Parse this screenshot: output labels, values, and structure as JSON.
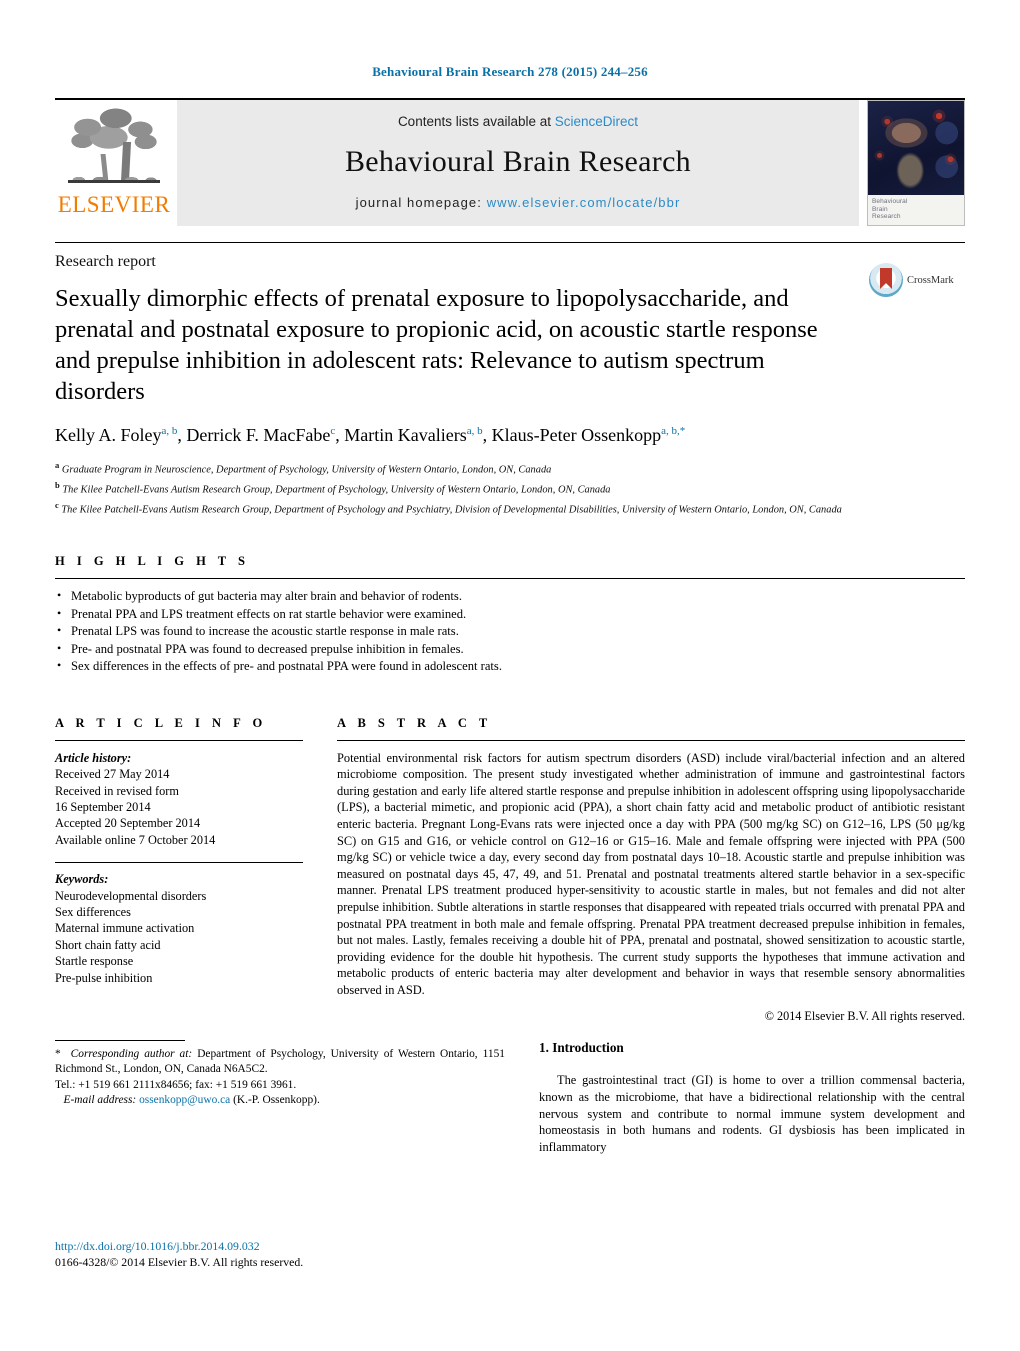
{
  "running_head": "Behavioural Brain Research 278 (2015) 244–256",
  "masthead": {
    "publisher_name": "ELSEVIER",
    "contents_prefix": "Contents lists available at ",
    "contents_link": "ScienceDirect",
    "journal_name": "Behavioural Brain Research",
    "homepage_prefix": "journal homepage: ",
    "homepage_url": "www.elsevier.com/locate/bbr",
    "cover_label_lines": [
      "Behavioural",
      "Brain",
      "Research"
    ]
  },
  "article": {
    "doctype": "Research report",
    "crossmark_label": "CrossMark",
    "title": "Sexually dimorphic effects of prenatal exposure to lipopolysaccharide, and prenatal and postnatal exposure to propionic acid, on acoustic startle response and prepulse inhibition in adolescent rats: Relevance to autism spectrum disorders",
    "authors_html": "Kelly A. Foley<sup>a, b</sup>, Derrick F. MacFabe<sup>c</sup>, Martin Kavaliers<sup>a, b</sup>, Klaus-Peter Ossenkopp<sup>a, b,</sup><sup>*</sup>",
    "affiliations": [
      {
        "mark": "a",
        "text": "Graduate Program in Neuroscience, Department of Psychology, University of Western Ontario, London, ON, Canada"
      },
      {
        "mark": "b",
        "text": "The Kilee Patchell-Evans Autism Research Group, Department of Psychology, University of Western Ontario, London, ON, Canada"
      },
      {
        "mark": "c",
        "text": "The Kilee Patchell-Evans Autism Research Group, Department of Psychology and Psychiatry, Division of Developmental Disabilities, University of Western Ontario, London, ON, Canada"
      }
    ]
  },
  "highlights": {
    "heading": "H I G H L I G H T S",
    "items": [
      "Metabolic byproducts of gut bacteria may alter brain and behavior of rodents.",
      "Prenatal PPA and LPS treatment effects on rat startle behavior were examined.",
      "Prenatal LPS was found to increase the acoustic startle response in male rats.",
      "Pre- and postnatal PPA was found to decreased prepulse inhibition in females.",
      "Sex differences in the effects of pre- and postnatal PPA were found in adolescent rats."
    ]
  },
  "article_info": {
    "heading": "A R T I C L E   I N F O",
    "history_label": "Article history:",
    "history_lines": [
      "Received 27 May 2014",
      "Received in revised form",
      "16 September 2014",
      "Accepted 20 September 2014",
      "Available online 7 October 2014"
    ],
    "keywords_label": "Keywords:",
    "keywords": [
      "Neurodevelopmental disorders",
      "Sex differences",
      "Maternal immune activation",
      "Short chain fatty acid",
      "Startle response",
      "Pre-pulse inhibition"
    ]
  },
  "abstract": {
    "heading": "A B S T R A C T",
    "text": "Potential environmental risk factors for autism spectrum disorders (ASD) include viral/bacterial infection and an altered microbiome composition. The present study investigated whether administration of immune and gastrointestinal factors during gestation and early life altered startle response and prepulse inhibition in adolescent offspring using lipopolysaccharide (LPS), a bacterial mimetic, and propionic acid (PPA), a short chain fatty acid and metabolic product of antibiotic resistant enteric bacteria. Pregnant Long-Evans rats were injected once a day with PPA (500 mg/kg SC) on G12–16, LPS (50 μg/kg SC) on G15 and G16, or vehicle control on G12–16 or G15–16. Male and female offspring were injected with PPA (500 mg/kg SC) or vehicle twice a day, every second day from postnatal days 10–18. Acoustic startle and prepulse inhibition was measured on postnatal days 45, 47, 49, and 51. Prenatal and postnatal treatments altered startle behavior in a sex-specific manner. Prenatal LPS treatment produced hyper-sensitivity to acoustic startle in males, but not females and did not alter prepulse inhibition. Subtle alterations in startle responses that disappeared with repeated trials occurred with prenatal PPA and postnatal PPA treatment in both male and female offspring. Prenatal PPA treatment decreased prepulse inhibition in females, but not males. Lastly, females receiving a double hit of PPA, prenatal and postnatal, showed sensitization to acoustic startle, providing evidence for the double hit hypothesis. The current study supports the hypotheses that immune activation and metabolic products of enteric bacteria may alter development and behavior in ways that resemble sensory abnormalities observed in ASD.",
    "copyright": "© 2014 Elsevier B.V. All rights reserved."
  },
  "footnote": {
    "corresponding_label": "Corresponding author at:",
    "corresponding_text": " Department of Psychology, University of Western Ontario, 1151 Richmond St., London, ON, Canada N6A5C2.",
    "tel_line": "Tel.: +1 519 661 2111x84656; fax: +1 519 661 3961.",
    "email_label": "E-mail address:",
    "email": "ossenkopp@uwo.ca",
    "email_suffix": " (K.-P. Ossenkopp)."
  },
  "footer": {
    "doi": "http://dx.doi.org/10.1016/j.bbr.2014.09.032",
    "issn_line": "0166-4328/© 2014 Elsevier B.V. All rights reserved."
  },
  "introduction": {
    "heading": "1.  Introduction",
    "paragraph": "The gastrointestinal tract (GI) is home to over a trillion commensal bacteria, known as the microbiome, that have a bidirectional relationship with the central nervous system and contribute to normal immune system development and homeostasis in both humans and rodents. GI dysbiosis has been implicated in inflammatory"
  },
  "colors": {
    "link": "#0a71a8",
    "elsevier_orange": "#f07d00",
    "masthead_bg": "#eaeaea"
  }
}
